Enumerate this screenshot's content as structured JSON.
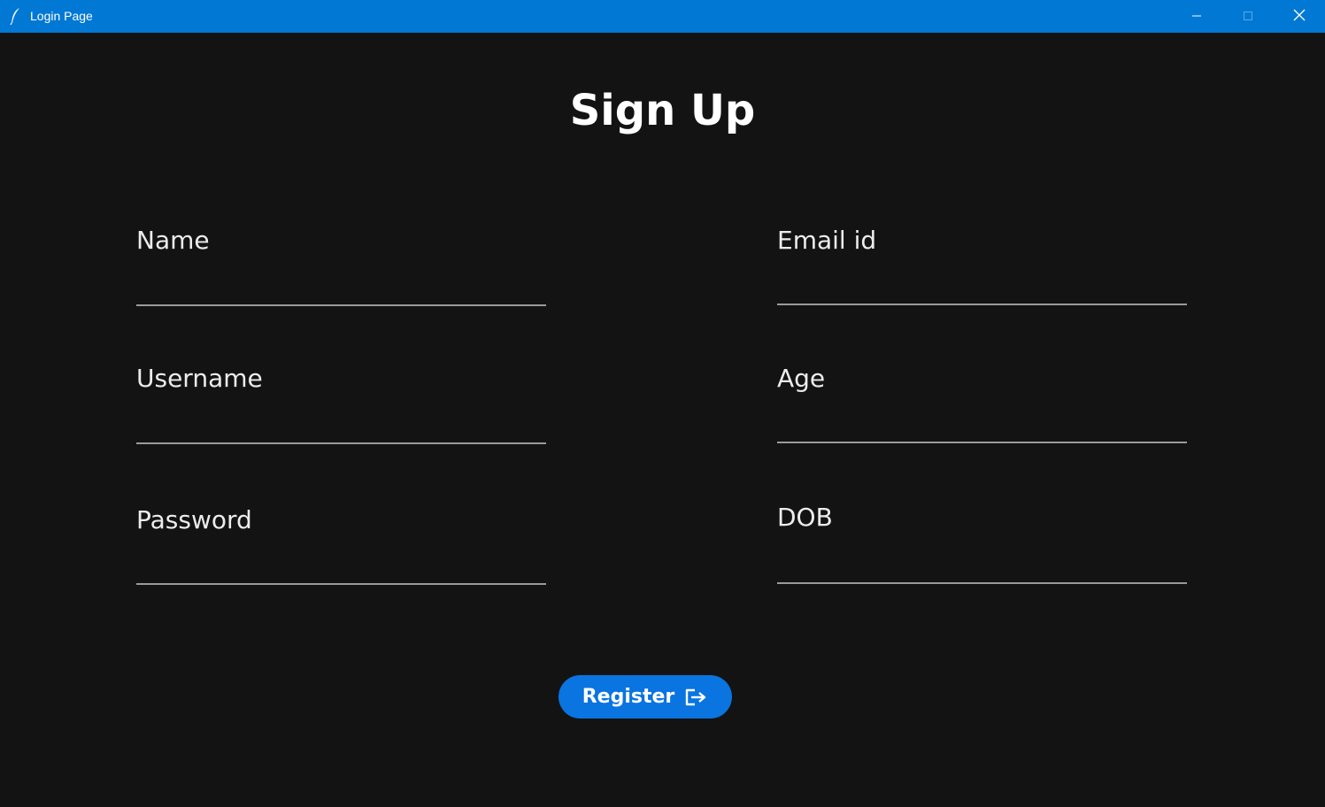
{
  "window": {
    "title": "Login Page",
    "accent_color": "#0078d4",
    "icon": "feather-icon",
    "controls": [
      "minimize-icon",
      "maximize-icon",
      "close-icon"
    ]
  },
  "form": {
    "heading": "Sign Up",
    "fields": {
      "name": {
        "label": "Name",
        "value": ""
      },
      "email": {
        "label": "Email id",
        "value": ""
      },
      "username": {
        "label": "Username",
        "value": ""
      },
      "age": {
        "label": "Age",
        "value": ""
      },
      "password": {
        "label": "Password",
        "value": ""
      },
      "dob": {
        "label": "DOB",
        "value": ""
      }
    },
    "register_button": {
      "label": "Register",
      "icon": "sign-out-icon",
      "color": "#0a74e0"
    }
  },
  "theme": {
    "background": "#131313",
    "underline": "#9a9a9a",
    "text": "#ececec"
  }
}
